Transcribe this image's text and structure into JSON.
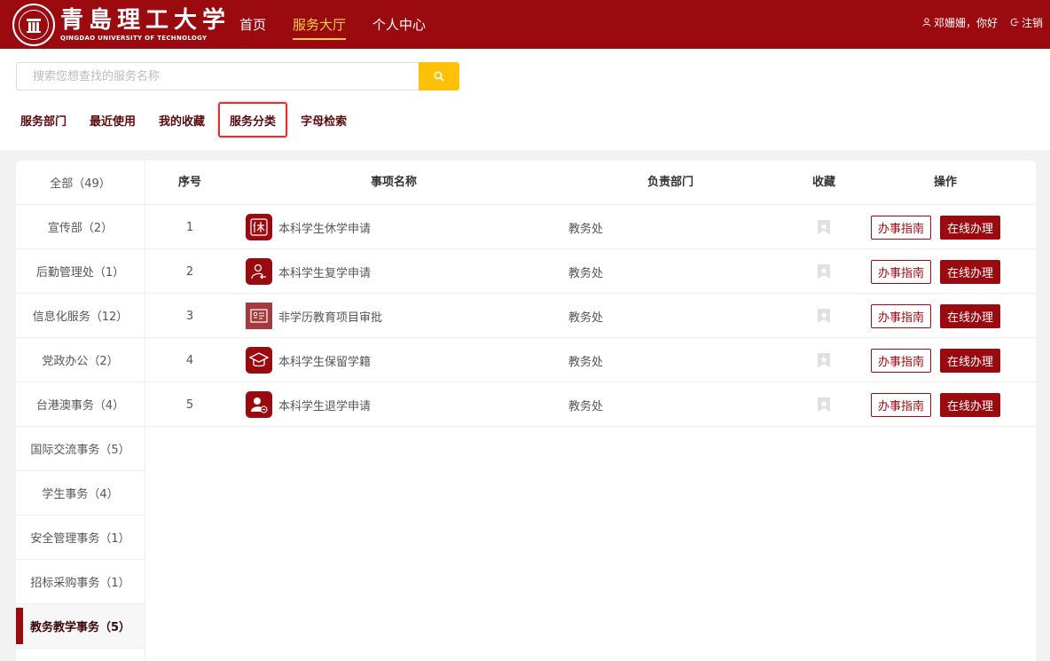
{
  "header": {
    "logo_cn": "青島理工大学",
    "logo_en": "QINGDAO UNIVERSITY OF TECHNOLOGY",
    "nav": [
      {
        "label": "首页"
      },
      {
        "label": "服务大厅",
        "active": true
      },
      {
        "label": "个人中心"
      }
    ],
    "user_greeting": "邓姗姗，你好",
    "logout_label": "注销"
  },
  "search": {
    "placeholder": "搜索您想查找的服务名称",
    "value": ""
  },
  "tabs": [
    {
      "label": "服务部门"
    },
    {
      "label": "最近使用"
    },
    {
      "label": "我的收藏"
    },
    {
      "label": "服务分类",
      "selected": true
    },
    {
      "label": "字母检索"
    }
  ],
  "sidebar": {
    "items": [
      {
        "label": "全部（49）"
      },
      {
        "label": "宣传部（2）"
      },
      {
        "label": "后勤管理处（1）"
      },
      {
        "label": "信息化服务（12）"
      },
      {
        "label": "党政办公（2）"
      },
      {
        "label": "台港澳事务（4）"
      },
      {
        "label": "国际交流事务（5）"
      },
      {
        "label": "学生事务（4）"
      },
      {
        "label": "安全管理事务（1）"
      },
      {
        "label": "招标采购事务（1）"
      },
      {
        "label": "教务教学事务（5）",
        "active": true
      }
    ]
  },
  "table": {
    "headers": {
      "index": "序号",
      "name": "事项名称",
      "dept": "负责部门",
      "fav": "收藏",
      "ops": "操作"
    },
    "rows": [
      {
        "index": "1",
        "name": "本科学生休学申请",
        "dept": "教务处",
        "icon": "rest-char-icon"
      },
      {
        "index": "2",
        "name": "本科学生复学申请",
        "dept": "教务处",
        "icon": "user-return-icon"
      },
      {
        "index": "3",
        "name": "非学历教育项目审批",
        "dept": "教务处",
        "icon": "certificate-icon"
      },
      {
        "index": "4",
        "name": "本科学生保留学籍",
        "dept": "教务处",
        "icon": "graduation-cap-icon"
      },
      {
        "index": "5",
        "name": "本科学生退学申请",
        "dept": "教务处",
        "icon": "user-remove-icon"
      }
    ],
    "guide_label": "办事指南",
    "online_label": "在线办理"
  },
  "colors": {
    "brand": "#9b0a0f",
    "accent": "#ffc107",
    "highlight": "#e0322e"
  }
}
